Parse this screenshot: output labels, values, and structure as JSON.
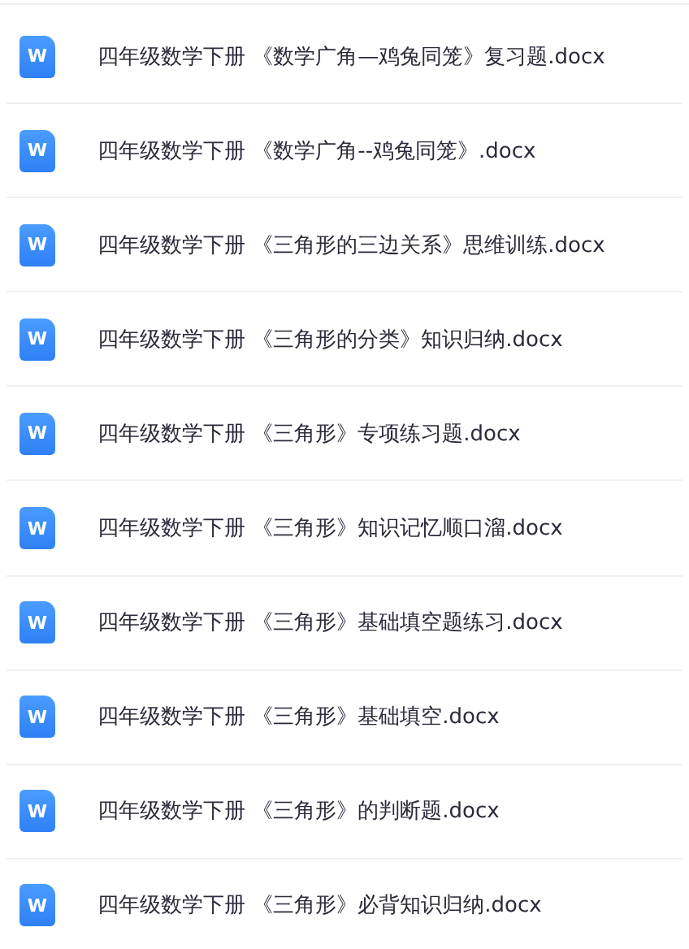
{
  "files": [
    {
      "icon_label": "W",
      "name": "四年级数学下册 《数学广角—鸡兔同笼》复习题.docx"
    },
    {
      "icon_label": "W",
      "name": "四年级数学下册 《数学广角--鸡兔同笼》.docx"
    },
    {
      "icon_label": "W",
      "name": "四年级数学下册 《三角形的三边关系》思维训练.docx"
    },
    {
      "icon_label": "W",
      "name": "四年级数学下册 《三角形的分类》知识归纳.docx"
    },
    {
      "icon_label": "W",
      "name": "四年级数学下册 《三角形》专项练习题.docx"
    },
    {
      "icon_label": "W",
      "name": "四年级数学下册 《三角形》知识记忆顺口溜.docx"
    },
    {
      "icon_label": "W",
      "name": "四年级数学下册 《三角形》基础填空题练习.docx"
    },
    {
      "icon_label": "W",
      "name": "四年级数学下册 《三角形》基础填空.docx"
    },
    {
      "icon_label": "W",
      "name": "四年级数学下册 《三角形》的判断题.docx"
    },
    {
      "icon_label": "W",
      "name": "四年级数学下册 《三角形》必背知识归纳.docx"
    }
  ]
}
